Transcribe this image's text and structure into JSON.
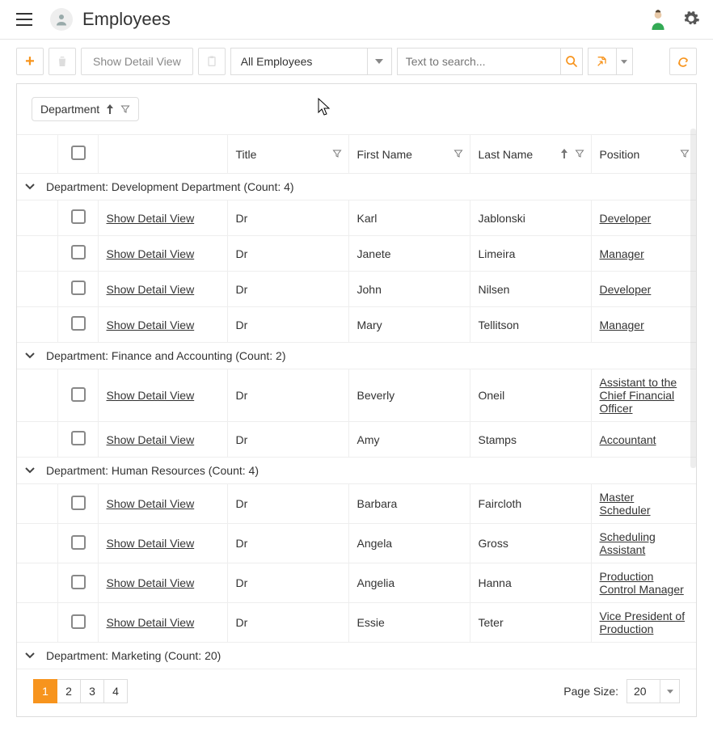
{
  "header": {
    "title": "Employees"
  },
  "toolbar": {
    "show_detail_label": "Show Detail View",
    "filter_select": "All Employees",
    "search_placeholder": "Text to search..."
  },
  "group_chip": "Department",
  "columns": {
    "title": "Title",
    "first_name": "First Name",
    "last_name": "Last Name",
    "position": "Position"
  },
  "detail_link_label": "Show Detail View",
  "groups": [
    {
      "header": "Department: Development Department (Count: 4)",
      "rows": [
        {
          "title": "Dr",
          "first": "Karl",
          "last": "Jablonski",
          "position": "Developer"
        },
        {
          "title": "Dr",
          "first": "Janete",
          "last": "Limeira",
          "position": "Manager"
        },
        {
          "title": "Dr",
          "first": "John",
          "last": "Nilsen",
          "position": "Developer"
        },
        {
          "title": "Dr",
          "first": "Mary",
          "last": "Tellitson",
          "position": "Manager"
        }
      ]
    },
    {
      "header": "Department: Finance and Accounting (Count: 2)",
      "rows": [
        {
          "title": "Dr",
          "first": "Beverly",
          "last": "Oneil",
          "position": "Assistant to the Chief Financial Officer"
        },
        {
          "title": "Dr",
          "first": "Amy",
          "last": "Stamps",
          "position": "Accountant"
        }
      ]
    },
    {
      "header": "Department: Human Resources (Count: 4)",
      "rows": [
        {
          "title": "Dr",
          "first": "Barbara",
          "last": "Faircloth",
          "position": "Master Scheduler"
        },
        {
          "title": "Dr",
          "first": "Angela",
          "last": "Gross",
          "position": "Scheduling Assistant"
        },
        {
          "title": "Dr",
          "first": "Angelia",
          "last": "Hanna",
          "position": "Production Control Manager"
        },
        {
          "title": "Dr",
          "first": "Essie",
          "last": "Teter",
          "position": "Vice President of Production"
        }
      ]
    },
    {
      "header": "Department: Marketing (Count: 20)",
      "rows": []
    }
  ],
  "pager": {
    "pages": [
      "1",
      "2",
      "3",
      "4"
    ],
    "active": "1",
    "page_size_label": "Page Size:",
    "page_size_value": "20"
  }
}
